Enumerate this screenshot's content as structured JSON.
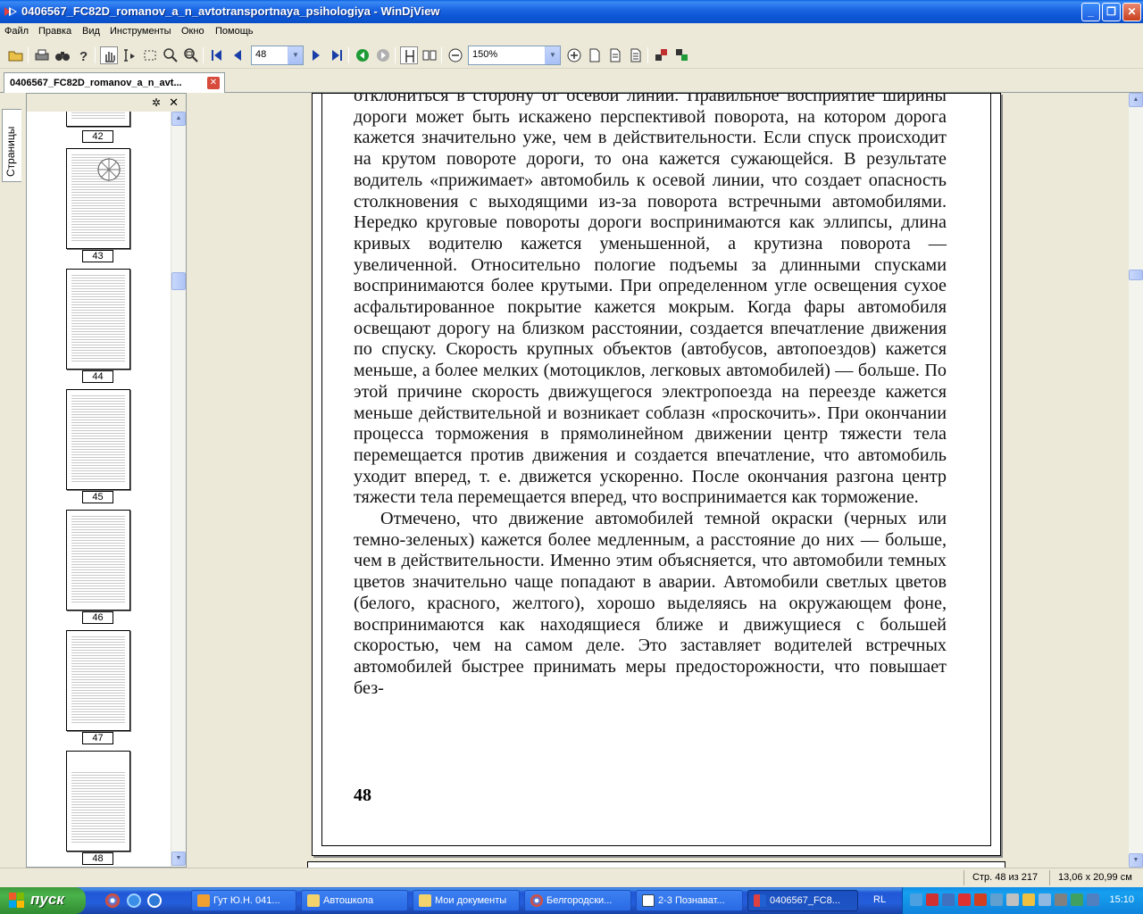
{
  "window": {
    "title": "0406567_FC82D_romanov_a_n_avtotransportnaya_psihologiya - WinDjView",
    "minimize": "_",
    "maximize": "❐",
    "close": "✕"
  },
  "menu": [
    "Файл",
    "Правка",
    "Вид",
    "Инструменты",
    "Окно",
    "Помощь"
  ],
  "toolbar": {
    "page_value": "48",
    "zoom_value": "150%"
  },
  "tab": {
    "label": "0406567_FC82D_romanov_a_n_avt...",
    "close": "✕"
  },
  "sidepanel": {
    "tab_label": "Страницы",
    "thumbnails": [
      "42",
      "43",
      "44",
      "45",
      "46",
      "47",
      "48"
    ]
  },
  "document": {
    "paragraph1": "отклониться в сторону от осевой линии. Правильное восприятие ширины дороги может быть искажено перспективой поворота, на котором дорога кажется значительно уже, чем в действительности. Если спуск происходит на крутом повороте дороги, то она кажется сужающейся. В результате водитель «прижимает» автомобиль к осевой линии, что создает опасность столкновения с выходящими из-за поворота встречными автомобилями. Нередко круговые повороты дороги воспринимаются как эллипсы, длина кривых водителю кажется уменьшенной, а крутизна поворота — увеличенной. Относительно пологие подъемы за длинными спусками воспринимаются более крутыми. При определенном угле освещения сухое асфальтированное покрытие кажется мокрым. Когда фары автомобиля освещают дорогу на близком расстоянии, создается впечатление движения по спуску. Скорость крупных объектов (автобусов, автопоездов) кажется меньше, а более мелких (мотоциклов, легковых автомобилей) — больше. По этой причине скорость движущегося электропоезда на переезде кажется меньше действительной и возникает соблазн «проскочить». При окончании процесса торможения в прямолинейном движении центр тяжести тела перемещается против движения и создается впечатление, что автомобиль уходит вперед, т. е. движется ускоренно. После окончания разгона центр тяжести тела перемещается вперед, что воспринимается как торможение.",
    "paragraph2": "Отмечено, что движение автомобилей темной окраски (черных или темно-зеленых) кажется более медленным, а расстояние до них — больше, чем в действительности. Именно этим объясняется, что автомобили темных цветов значительно чаще попадают в аварии. Автомобили светлых цветов (белого, красного, желтого), хорошо выделяясь на окружающем фоне, воспринимаются как находящиеся ближе и движущиеся с большей скоростью, чем на самом деле. Это заставляет водителей встречных автомобилей быстрее принимать меры предосторожности, что повышает без-",
    "page_number": "48"
  },
  "status": {
    "page_info": "Стр. 48 из 217",
    "page_size": "13,06 x 20,99 см"
  },
  "taskbar": {
    "start": "пуск",
    "tasks": [
      "Гут Ю.Н. 041...",
      "Автошкола",
      "Мои документы",
      "Белгородски...",
      "2-3 Познават...",
      "0406567_FC8..."
    ],
    "lang": "RL",
    "clock": "15:10"
  }
}
